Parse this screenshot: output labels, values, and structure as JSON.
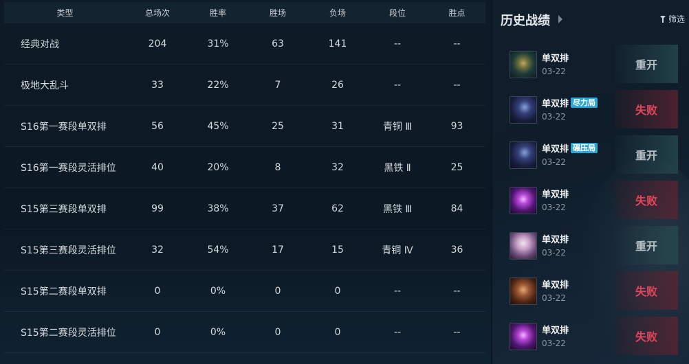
{
  "stats": {
    "headers": {
      "type": "类型",
      "total": "总场次",
      "rate": "胜率",
      "wins": "胜场",
      "losses": "负场",
      "tier": "段位",
      "lp": "胜点"
    },
    "rows": [
      {
        "type": "经典对战",
        "total": "204",
        "rate": "31%",
        "wins": "63",
        "losses": "141",
        "tier": "--",
        "lp": "--"
      },
      {
        "type": "极地大乱斗",
        "total": "33",
        "rate": "22%",
        "wins": "7",
        "losses": "26",
        "tier": "--",
        "lp": "--"
      },
      {
        "type": "S16第一赛段单双排",
        "total": "56",
        "rate": "45%",
        "wins": "25",
        "losses": "31",
        "tier": "青铜 Ⅲ",
        "lp": "93"
      },
      {
        "type": "S16第一赛段灵活排位",
        "total": "40",
        "rate": "20%",
        "wins": "8",
        "losses": "32",
        "tier": "黑铁 Ⅱ",
        "lp": "25"
      },
      {
        "type": "S15第三赛段单双排",
        "total": "99",
        "rate": "38%",
        "wins": "37",
        "losses": "62",
        "tier": "黑铁 Ⅲ",
        "lp": "84"
      },
      {
        "type": "S15第三赛段灵活排位",
        "total": "32",
        "rate": "54%",
        "wins": "17",
        "losses": "15",
        "tier": "青铜 Ⅳ",
        "lp": "36"
      },
      {
        "type": "S15第二赛段单双排",
        "total": "0",
        "rate": "0%",
        "wins": "0",
        "losses": "0",
        "tier": "--",
        "lp": "--"
      },
      {
        "type": "S15第二赛段灵活排位",
        "total": "0",
        "rate": "0%",
        "wins": "0",
        "losses": "0",
        "tier": "--",
        "lp": "--"
      }
    ]
  },
  "history": {
    "title": "历史战绩",
    "filter_label": "筛选",
    "matches": [
      {
        "queue": "单双排",
        "tag": "",
        "date": "03-22",
        "result": "重开",
        "result_kind": "remake",
        "portrait": "p-green"
      },
      {
        "queue": "单双排",
        "tag": "尽力局",
        "date": "03-22",
        "result": "失败",
        "result_kind": "loss",
        "portrait": "p-dark"
      },
      {
        "queue": "单双排",
        "tag": "碾压局",
        "date": "03-22",
        "result": "重开",
        "result_kind": "remake",
        "portrait": "p-dark"
      },
      {
        "queue": "单双排",
        "tag": "",
        "date": "03-22",
        "result": "失败",
        "result_kind": "loss",
        "portrait": "p-purple"
      },
      {
        "queue": "单双排",
        "tag": "",
        "date": "03-22",
        "result": "重开",
        "result_kind": "remake",
        "portrait": "p-light"
      },
      {
        "queue": "单双排",
        "tag": "",
        "date": "03-22",
        "result": "失败",
        "result_kind": "loss",
        "portrait": "p-brown"
      },
      {
        "queue": "单双排",
        "tag": "",
        "date": "03-22",
        "result": "失败",
        "result_kind": "loss",
        "portrait": "p-purple"
      }
    ]
  }
}
